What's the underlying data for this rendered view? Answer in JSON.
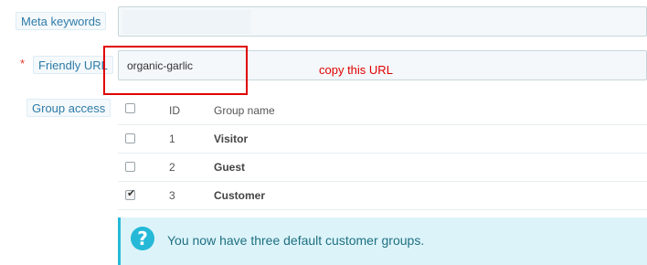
{
  "form": {
    "meta_keywords": {
      "label": "Meta keywords",
      "value": ""
    },
    "friendly_url": {
      "required_marker": "*",
      "label": "Friendly URL",
      "value": "organic-garlic"
    },
    "group_access": {
      "label": "Group access",
      "columns": {
        "id": "ID",
        "name": "Group name"
      },
      "groups": [
        {
          "id": "1",
          "name": "Visitor",
          "checked": false
        },
        {
          "id": "2",
          "name": "Guest",
          "checked": false
        },
        {
          "id": "3",
          "name": "Customer",
          "checked": true
        }
      ]
    }
  },
  "annotation": {
    "text": "copy this URL",
    "color": "#e00000"
  },
  "alert": {
    "icon": "question-icon",
    "icon_glyph": "?",
    "text": "You now have three default customer groups."
  },
  "colors": {
    "label_text": "#2e7ba8",
    "required": "#e3382a",
    "alert_accent": "#25b9d7",
    "alert_bg": "#dcf4f9"
  }
}
